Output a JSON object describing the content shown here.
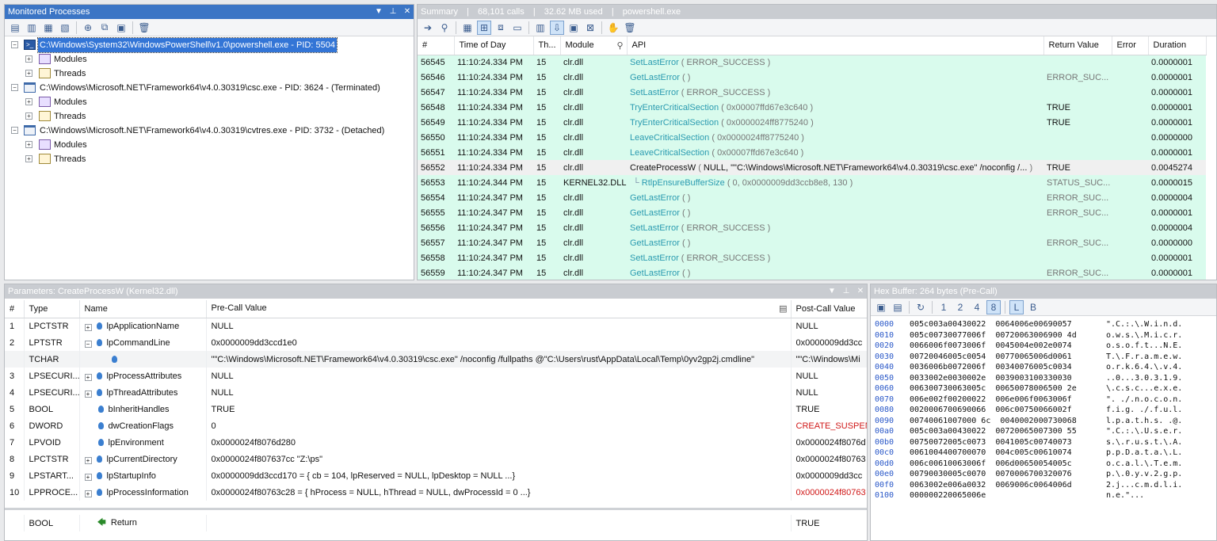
{
  "monitored": {
    "title": "Monitored Processes",
    "processes": [
      {
        "label": "C:\\Windows\\System32\\WindowsPowerShell\\v1.0\\powershell.exe - PID: 5504",
        "children": [
          "Modules",
          "Threads"
        ]
      },
      {
        "label": "C:\\Windows\\Microsoft.NET\\Framework64\\v4.0.30319\\csc.exe - PID: 3624 - (Terminated)",
        "children": [
          "Modules",
          "Threads"
        ]
      },
      {
        "label": "C:\\Windows\\Microsoft.NET\\Framework64\\v4.0.30319\\cvtres.exe - PID: 3732 - (Detached)",
        "children": [
          "Modules",
          "Threads"
        ]
      }
    ]
  },
  "summary": {
    "tab": "Summary",
    "calls": "68,101 calls",
    "memory": "32.62 MB used",
    "process": "powershell.exe",
    "columns": [
      "#",
      "Time of Day",
      "Th...",
      "Module",
      "API",
      "Return Value",
      "Error",
      "Duration"
    ],
    "rows": [
      {
        "n": "56545",
        "time": "11:10:24.334 PM",
        "th": "15",
        "mod": "clr.dll",
        "fn": "SetLastError",
        "args": "ERROR_SUCCESS",
        "ret": "",
        "err": "",
        "dur": "0.0000001",
        "style": "green"
      },
      {
        "n": "56546",
        "time": "11:10:24.334 PM",
        "th": "15",
        "mod": "clr.dll",
        "fn": "GetLastError",
        "args": "",
        "ret": "ERROR_SUC...",
        "err": "",
        "dur": "0.0000001",
        "style": "green"
      },
      {
        "n": "56547",
        "time": "11:10:24.334 PM",
        "th": "15",
        "mod": "clr.dll",
        "fn": "SetLastError",
        "args": "ERROR_SUCCESS",
        "ret": "",
        "err": "",
        "dur": "0.0000001",
        "style": "green"
      },
      {
        "n": "56548",
        "time": "11:10:24.334 PM",
        "th": "15",
        "mod": "clr.dll",
        "fn": "TryEnterCriticalSection",
        "args": "0x00007ffd67e3c640",
        "ret": "TRUE",
        "err": "",
        "dur": "0.0000001",
        "style": "green"
      },
      {
        "n": "56549",
        "time": "11:10:24.334 PM",
        "th": "15",
        "mod": "clr.dll",
        "fn": "TryEnterCriticalSection",
        "args": "0x0000024ff8775240",
        "ret": "TRUE",
        "err": "",
        "dur": "0.0000001",
        "style": "green"
      },
      {
        "n": "56550",
        "time": "11:10:24.334 PM",
        "th": "15",
        "mod": "clr.dll",
        "fn": "LeaveCriticalSection",
        "args": "0x0000024ff8775240",
        "ret": "",
        "err": "",
        "dur": "0.0000000",
        "style": "green"
      },
      {
        "n": "56551",
        "time": "11:10:24.334 PM",
        "th": "15",
        "mod": "clr.dll",
        "fn": "LeaveCriticalSection",
        "args": "0x00007ffd67e3c640",
        "ret": "",
        "err": "",
        "dur": "0.0000001",
        "style": "green"
      },
      {
        "n": "56552",
        "time": "11:10:24.334 PM",
        "th": "15",
        "mod": "clr.dll",
        "fn": "CreateProcessW",
        "args": "NULL, \"\"C:\\Windows\\Microsoft.NET\\Framework64\\v4.0.30319\\csc.exe\" /noconfig /...",
        "ret": "TRUE",
        "err": "",
        "dur": "0.0045274",
        "style": "sel"
      },
      {
        "n": "56553",
        "time": "11:10:24.344 PM",
        "th": "15",
        "mod": "KERNEL32.DLL",
        "fn": "RtlpEnsureBufferSize",
        "args": "0, 0x0000009dd3ccb8e8, 130",
        "ret": "STATUS_SUC...",
        "err": "",
        "dur": "0.0000015",
        "style": "green",
        "child": true
      },
      {
        "n": "56554",
        "time": "11:10:24.347 PM",
        "th": "15",
        "mod": "clr.dll",
        "fn": "GetLastError",
        "args": "",
        "ret": "ERROR_SUC...",
        "err": "",
        "dur": "0.0000004",
        "style": "green"
      },
      {
        "n": "56555",
        "time": "11:10:24.347 PM",
        "th": "15",
        "mod": "clr.dll",
        "fn": "GetLastError",
        "args": "",
        "ret": "ERROR_SUC...",
        "err": "",
        "dur": "0.0000001",
        "style": "green"
      },
      {
        "n": "56556",
        "time": "11:10:24.347 PM",
        "th": "15",
        "mod": "clr.dll",
        "fn": "SetLastError",
        "args": "ERROR_SUCCESS",
        "ret": "",
        "err": "",
        "dur": "0.0000004",
        "style": "green"
      },
      {
        "n": "56557",
        "time": "11:10:24.347 PM",
        "th": "15",
        "mod": "clr.dll",
        "fn": "GetLastError",
        "args": "",
        "ret": "ERROR_SUC...",
        "err": "",
        "dur": "0.0000000",
        "style": "green"
      },
      {
        "n": "56558",
        "time": "11:10:24.347 PM",
        "th": "15",
        "mod": "clr.dll",
        "fn": "SetLastError",
        "args": "ERROR_SUCCESS",
        "ret": "",
        "err": "",
        "dur": "0.0000001",
        "style": "green"
      },
      {
        "n": "56559",
        "time": "11:10:24.347 PM",
        "th": "15",
        "mod": "clr.dll",
        "fn": "GetLastError",
        "args": "",
        "ret": "ERROR_SUC...",
        "err": "",
        "dur": "0.0000001",
        "style": "green"
      }
    ]
  },
  "parameters": {
    "title": "Parameters: CreateProcessW (Kernel32.dll)",
    "columns": [
      "#",
      "Type",
      "Name",
      "Pre-Call Value",
      "Post-Call Value"
    ],
    "rows": [
      {
        "n": "1",
        "type": "LPCTSTR",
        "name": "lpApplicationName",
        "pre": "NULL",
        "post": "NULL",
        "exp": true
      },
      {
        "n": "2",
        "type": "LPTSTR",
        "name": "lpCommandLine",
        "pre": "0x0000009dd3ccd1e0",
        "post": "0x0000009dd3cc",
        "exp": true,
        "open": true
      },
      {
        "n": "",
        "type": "TCHAR",
        "name": "",
        "pre": "\"\"C:\\Windows\\Microsoft.NET\\Framework64\\v4.0.30319\\csc.exe\" /noconfig /fullpaths @\"C:\\Users\\rust\\AppData\\Local\\Temp\\0yv2gp2j.cmdline\"",
        "post": "\"\"C:\\Windows\\Mi",
        "sub": true
      },
      {
        "n": "3",
        "type": "LPSECURI...",
        "name": "lpProcessAttributes",
        "pre": "NULL",
        "post": "NULL",
        "exp": true
      },
      {
        "n": "4",
        "type": "LPSECURI...",
        "name": "lpThreadAttributes",
        "pre": "NULL",
        "post": "NULL",
        "exp": true
      },
      {
        "n": "5",
        "type": "BOOL",
        "name": "bInheritHandles",
        "pre": "TRUE",
        "post": "TRUE"
      },
      {
        "n": "6",
        "type": "DWORD",
        "name": "dwCreationFlags",
        "pre": "0",
        "post": "CREATE_SUSPEND",
        "postRed": true
      },
      {
        "n": "7",
        "type": "LPVOID",
        "name": "lpEnvironment",
        "pre": "0x0000024f8076d280",
        "post": "0x0000024f8076d"
      },
      {
        "n": "8",
        "type": "LPCTSTR",
        "name": "lpCurrentDirectory",
        "pre": "0x0000024f807637cc \"Z:\\ps\"",
        "post": "0x0000024f80763",
        "exp": true
      },
      {
        "n": "9",
        "type": "LPSTART...",
        "name": "lpStartupInfo",
        "pre": "0x0000009dd3ccd170 = { cb = 104, lpReserved = NULL, lpDesktop = NULL  ...}",
        "post": "0x0000009dd3cc",
        "exp": true
      },
      {
        "n": "10",
        "type": "LPPROCE...",
        "name": "lpProcessInformation",
        "pre": "0x0000024f80763c28 = { hProcess = NULL, hThread = NULL, dwProcessId = 0  ...}",
        "post": "0x0000024f80763",
        "exp": true,
        "postRed": true
      }
    ],
    "return": {
      "type": "BOOL",
      "name": "Return",
      "post": "TRUE"
    }
  },
  "hex": {
    "title": "Hex Buffer: 264 bytes (Pre-Call)",
    "rows": [
      {
        "off": "0000",
        "b1": "005c003a00430022",
        "b2": "0064006e00690057",
        "ascii": "\".C.:.\\.W.i.n.d."
      },
      {
        "off": "0010",
        "b1": "005c00730077006f",
        "b2": "00720063006900 4d",
        "ascii": "o.w.s.\\.M.i.c.r."
      },
      {
        "off": "0020",
        "b1": "0066006f0073006f",
        "b2": "0045004e002e0074",
        "ascii": "o.s.o.f.t...N.E."
      },
      {
        "off": "0030",
        "b1": "00720046005c0054",
        "b2": "00770065006d0061",
        "ascii": "T.\\.F.r.a.m.e.w."
      },
      {
        "off": "0040",
        "b1": "0036006b0072006f",
        "b2": "00340076005c0034",
        "ascii": "o.r.k.6.4.\\.v.4."
      },
      {
        "off": "0050",
        "b1": "0033002e0030002e",
        "b2": "0039003100330030",
        "ascii": "..0...3.0.3.1.9."
      },
      {
        "off": "0060",
        "b1": "006300730063005c",
        "b2": "00650078006500 2e",
        "ascii": "\\.c.s.c...e.x.e."
      },
      {
        "off": "0070",
        "b1": "006e002f00200022",
        "b2": "006e006f0063006f",
        "ascii": "\". ./.n.o.c.o.n."
      },
      {
        "off": "0080",
        "b1": "0020006700690066",
        "b2": "006c00750066002f",
        "ascii": "f.i.g. ./.f.u.l."
      },
      {
        "off": "0090",
        "b1": "00740061007000 6c",
        "b2": "0040002000730068",
        "ascii": "l.p.a.t.h.s. .@."
      },
      {
        "off": "00a0",
        "b1": "005c003a00430022",
        "b2": "00720065007300 55",
        "ascii": "\".C.:.\\.U.s.e.r."
      },
      {
        "off": "00b0",
        "b1": "00750072005c0073",
        "b2": "0041005c00740073",
        "ascii": "s.\\.r.u.s.t.\\.A."
      },
      {
        "off": "00c0",
        "b1": "0061004400700070",
        "b2": "004c005c00610074",
        "ascii": "p.p.D.a.t.a.\\.L."
      },
      {
        "off": "00d0",
        "b1": "006c00610063006f",
        "b2": "006d00650054005c",
        "ascii": "o.c.a.l.\\.T.e.m."
      },
      {
        "off": "00e0",
        "b1": "00790030005c0070",
        "b2": "0070006700320076",
        "ascii": "p.\\.0.y.v.2.g.p."
      },
      {
        "off": "00f0",
        "b1": "0063002e006a0032",
        "b2": "0069006c0064006d",
        "ascii": "2.j...c.m.d.l.i."
      },
      {
        "off": "0100",
        "b1": "000000220065006e",
        "b2": "",
        "ascii": "n.e.\"..."
      }
    ]
  }
}
